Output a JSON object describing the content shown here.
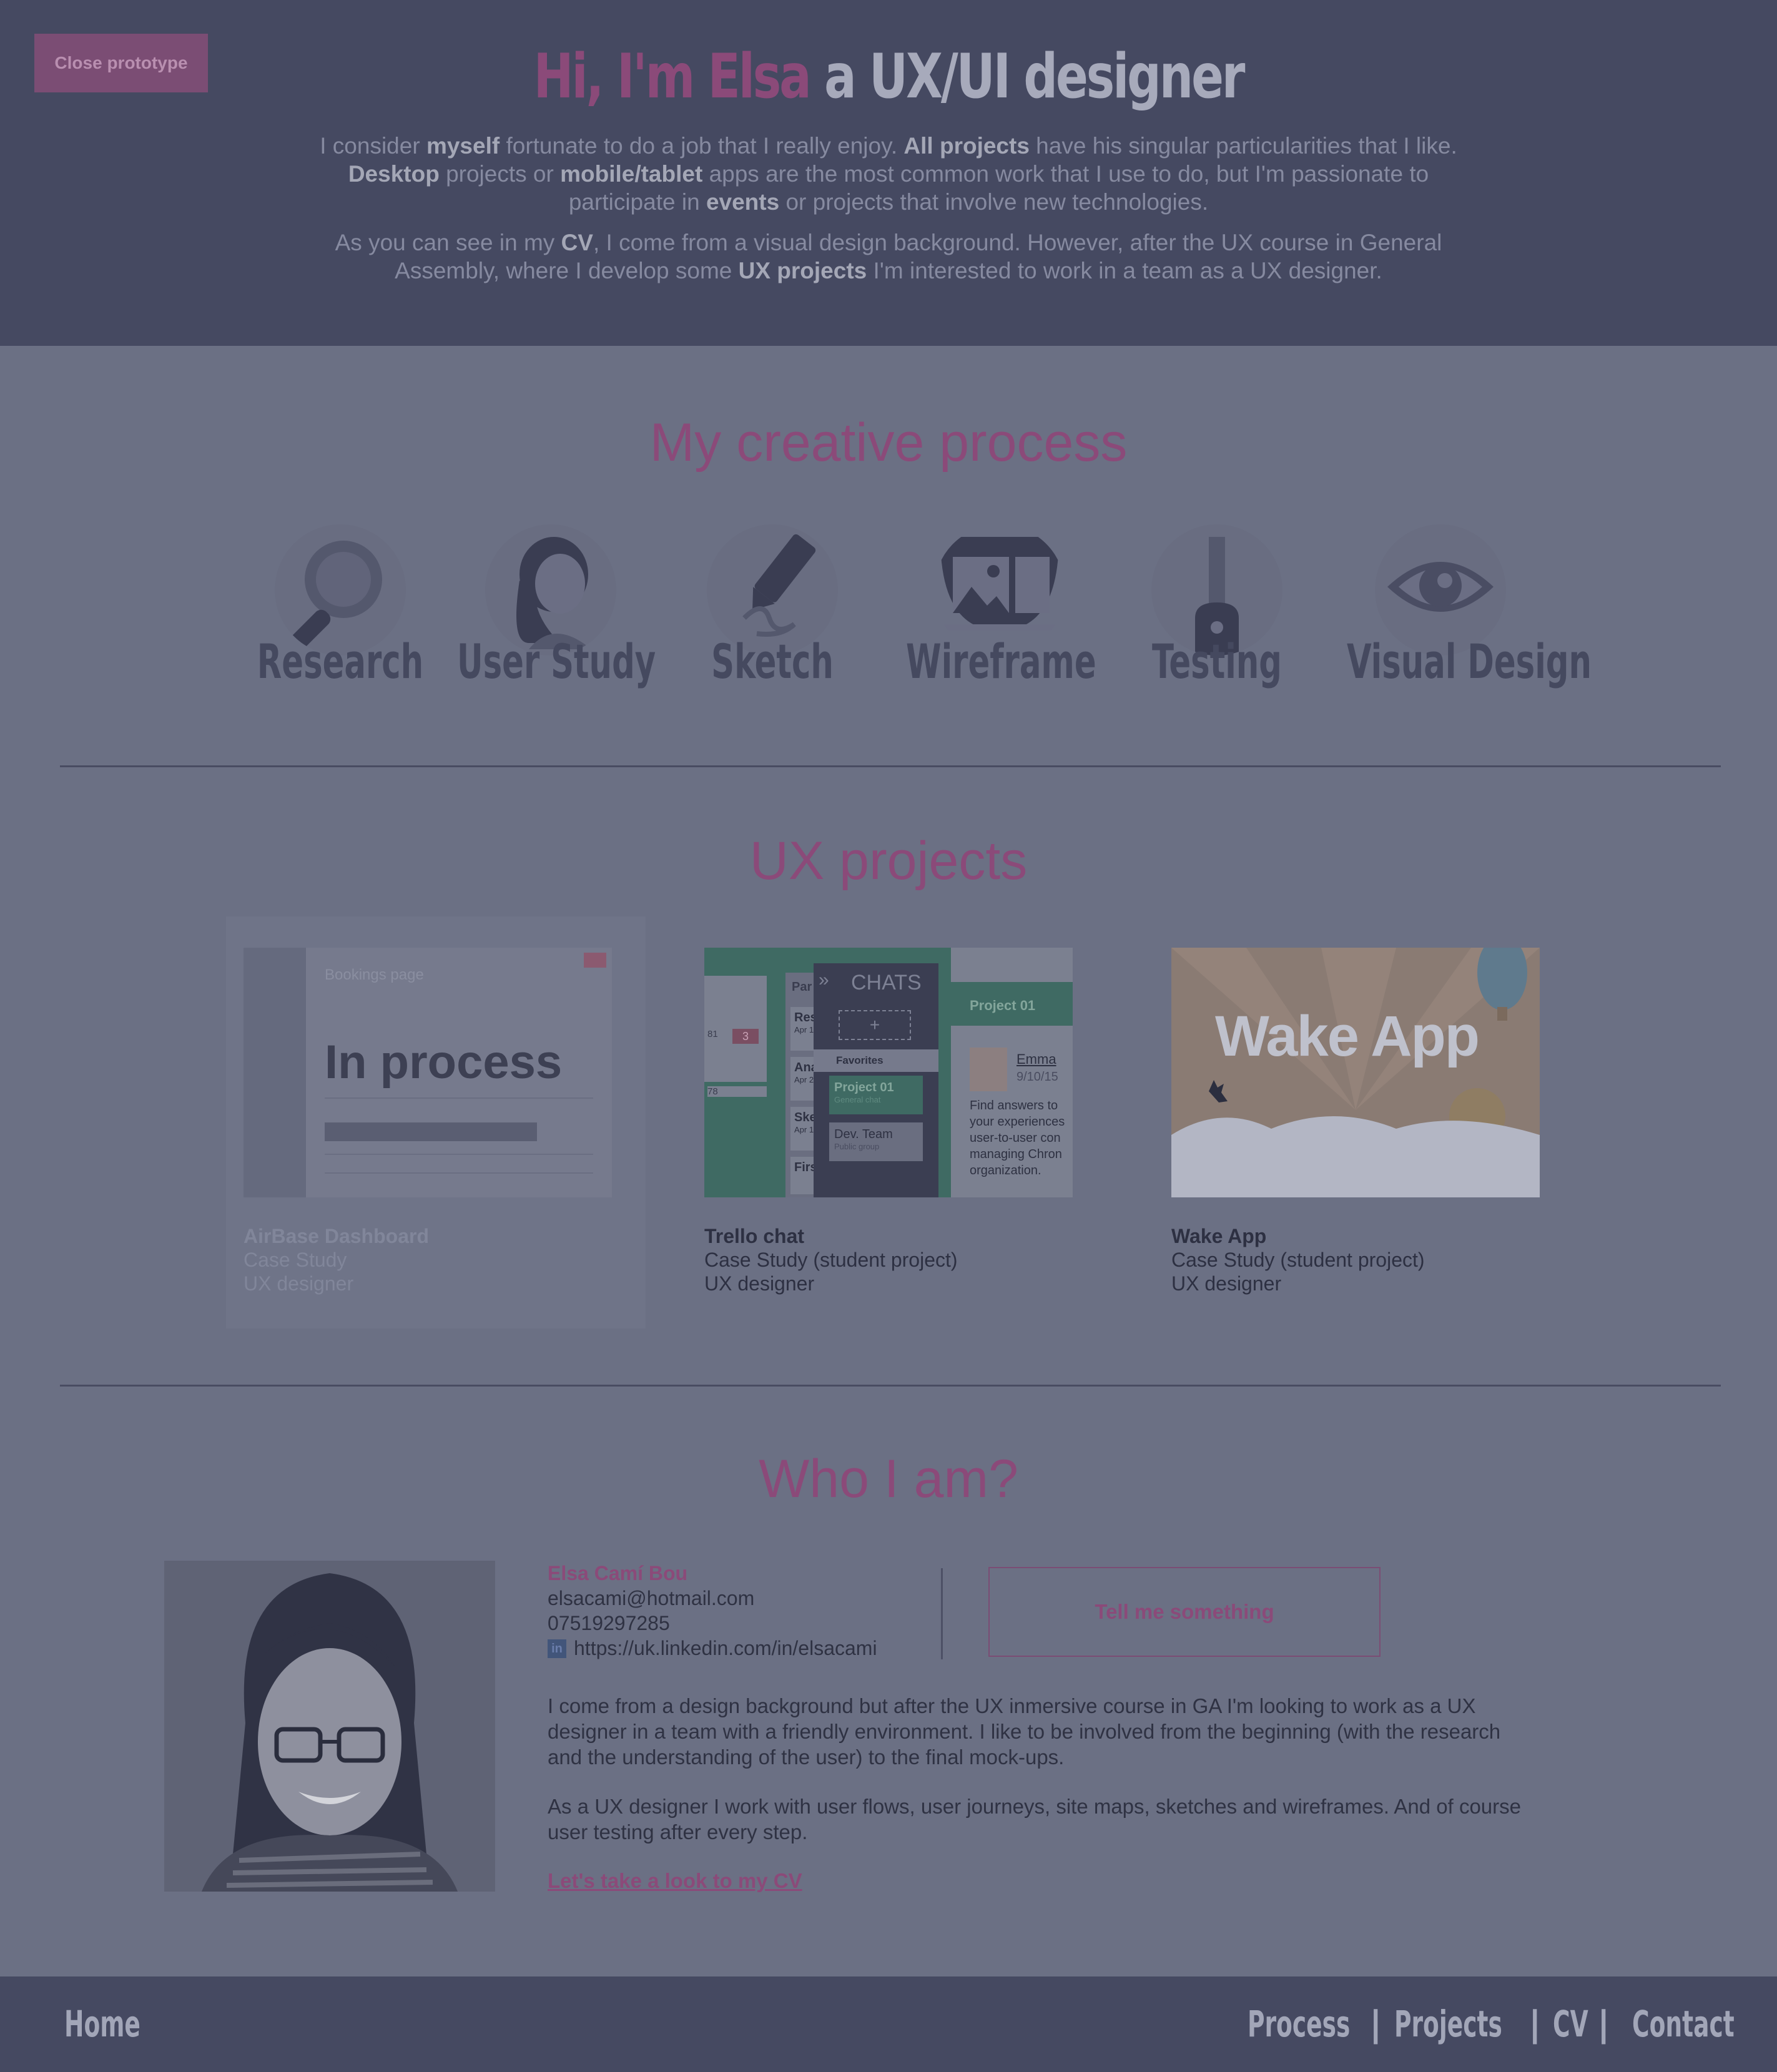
{
  "header": {
    "close_button": "Close prototype",
    "title_highlight": "Hi, I'm Elsa",
    "title_rest": " a UX/UI designer",
    "intro1": [
      {
        "t": "I consider ",
        "b": false
      },
      {
        "t": "myself",
        "b": true
      },
      {
        "t": " fortunate to do a job that I really enjoy. ",
        "b": false
      },
      {
        "t": "All projects",
        "b": true
      },
      {
        "t": " have his singular particularities that I like. ",
        "b": false
      },
      {
        "t": "Desktop",
        "b": true
      },
      {
        "t": " projects or ",
        "b": false
      },
      {
        "t": "mobile/tablet",
        "b": true
      },
      {
        "t": " apps are the most common work that I use to do, but I'm passionate to participate in ",
        "b": false
      },
      {
        "t": "events",
        "b": true
      },
      {
        "t": " or projects that involve new technologies.",
        "b": false
      }
    ],
    "intro2": [
      {
        "t": "As you can see in my ",
        "b": false
      },
      {
        "t": "CV",
        "b": true
      },
      {
        "t": ", I come from a visual design background. However, after the UX course in General Assembly, where I develop some ",
        "b": false
      },
      {
        "t": "UX projects",
        "b": true
      },
      {
        "t": " I'm interested to work in a team as a UX designer.",
        "b": false
      }
    ]
  },
  "process": {
    "title": "My creative process",
    "steps": [
      {
        "label": "Research",
        "icon": "magnifier-icon"
      },
      {
        "label": "User Study",
        "icon": "user-icon"
      },
      {
        "label": "Sketch",
        "icon": "marker-icon"
      },
      {
        "label": "Wireframe",
        "icon": "wireframe-icon"
      },
      {
        "label": "Testing",
        "icon": "flask-icon"
      },
      {
        "label": "Visual Design",
        "icon": "eye-icon"
      }
    ]
  },
  "projects": {
    "title": "UX projects",
    "items": [
      {
        "image_text": "In process",
        "image_caption": "Bookings page",
        "title": "AirBase Dashboard",
        "line1": "Case Study",
        "line2": "UX designer"
      },
      {
        "image_text": "CHATS",
        "title": "Trello chat",
        "line1": "Case Study (student project)",
        "line2": "UX designer",
        "thumb": {
          "list_header": "Par",
          "cards": [
            "Rese",
            "Anal",
            "Skec",
            "First"
          ],
          "card_dates": [
            "Apr 16",
            "Apr 23",
            "Apr 16"
          ],
          "badge": "3",
          "side_number": "78",
          "side_number2": "81",
          "favorites": "Favorites",
          "group1_title": "Project 01",
          "group1_sub": "General chat",
          "group2_title": "Dev. Team",
          "group2_sub": "Public group",
          "panel_title": "Project 01",
          "user_name": "Emma",
          "user_date": "9/10/15",
          "message": "Find answers to your experiences user-to-user con managing Chron organization."
        }
      },
      {
        "image_text": "Wake App",
        "title": "Wake App",
        "line1": "Case Study (student project)",
        "line2": "UX designer"
      }
    ]
  },
  "about": {
    "title": "Who I am?",
    "name": "Elsa Camí Bou",
    "email": "elsacami@hotmail.com",
    "phone": "07519297285",
    "linkedin": "https://uk.linkedin.com/in/elsacami",
    "linkedin_icon": "linkedin-icon",
    "tell_button": "Tell me something",
    "bio1": "I come from a design background but after the UX inmersive course in GA I'm looking to work as a UX designer in a team with a friendly environment. I like to be involved from the beginning (with the research and the understanding of the user) to the final mock-ups.",
    "bio2": "As a UX designer I work with user flows, user journeys, site maps, sketches and wireframes. And of course user testing after every step.",
    "cv_link": "Let's take a look to my CV"
  },
  "footer": {
    "home": "Home",
    "nav": [
      "Process",
      "Projects",
      "CV",
      "Contact"
    ],
    "separator": "|"
  },
  "colors": {
    "overlay_dark": "#454961",
    "overlay_body": "#6b7084",
    "accent": "#8b4a79"
  }
}
